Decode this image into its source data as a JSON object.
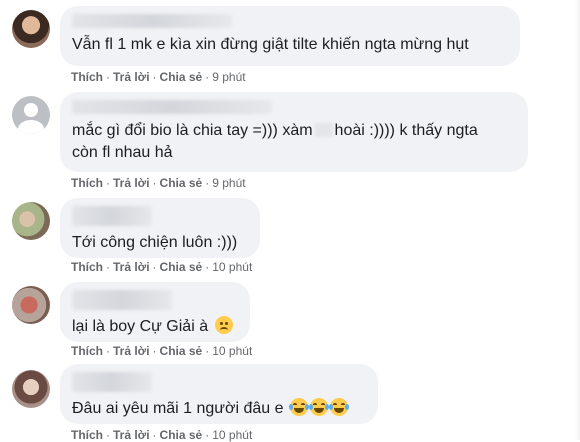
{
  "labels": {
    "like": "Thích",
    "reply": "Trả lời",
    "share": "Chia sẻ",
    "sep": "·"
  },
  "comments": [
    {
      "text": "Vẫn fl 1 mk e kìa xin đừng giật tilte khiến ngta mừng hụt",
      "time": "9 phút"
    },
    {
      "text_a": "mắc gì đổi bio là chia tay =))) xàm",
      "text_b": "hoài :)))) k thấy ngta",
      "text_c": "còn fl nhau hả",
      "time": "9 phút"
    },
    {
      "text": "Tới công chiện luôn :)))",
      "time": "10 phút"
    },
    {
      "text": "lại là boy Cự Giải à",
      "emoji": "sad-face-icon",
      "time": "10 phút"
    },
    {
      "text": "Đâu ai yêu mãi 1 người đâu e",
      "emoji": "laughing-tears-icon",
      "time": "10 phút"
    }
  ],
  "colors": {
    "bubble": "#f0f2f5",
    "meta": "#65676b",
    "text": "#1c1e21"
  }
}
